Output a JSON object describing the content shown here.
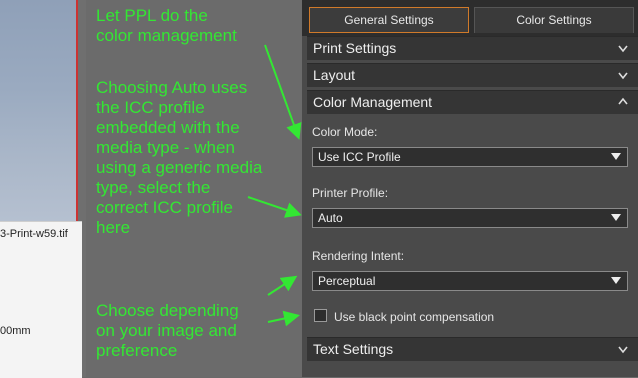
{
  "left": {
    "file_name": "3-Print-w59.tif",
    "size_text": "00mm"
  },
  "annotations": {
    "note1": "Let PPL do the\ncolor management",
    "note2": "Choosing Auto uses\nthe ICC profile\nembedded with the\nmedia type - when\nusing a generic media\ntype, select the\ncorrect ICC profile\nhere",
    "note3": "Choose depending\non your image and\npreference",
    "color": "#33e733"
  },
  "tabs": [
    {
      "label": "General Settings",
      "active": true
    },
    {
      "label": "Color Settings",
      "active": false
    }
  ],
  "sections": {
    "print_settings": "Print Settings",
    "layout": "Layout",
    "color_management": "Color Management",
    "text_settings": "Text Settings"
  },
  "fields": {
    "color_mode_label": "Color Mode:",
    "color_mode_value": "Use ICC Profile",
    "printer_profile_label": "Printer Profile:",
    "printer_profile_value": "Auto",
    "rendering_intent_label": "Rendering Intent:",
    "rendering_intent_value": "Perceptual",
    "black_point_label": "Use black point compensation",
    "black_point_checked": false
  },
  "colors": {
    "accent": "#d07a2a",
    "panel_bg": "#4a4a4a"
  },
  "icons": [
    "chevron-down-icon",
    "chevron-up-icon",
    "dropdown-arrow-icon"
  ]
}
